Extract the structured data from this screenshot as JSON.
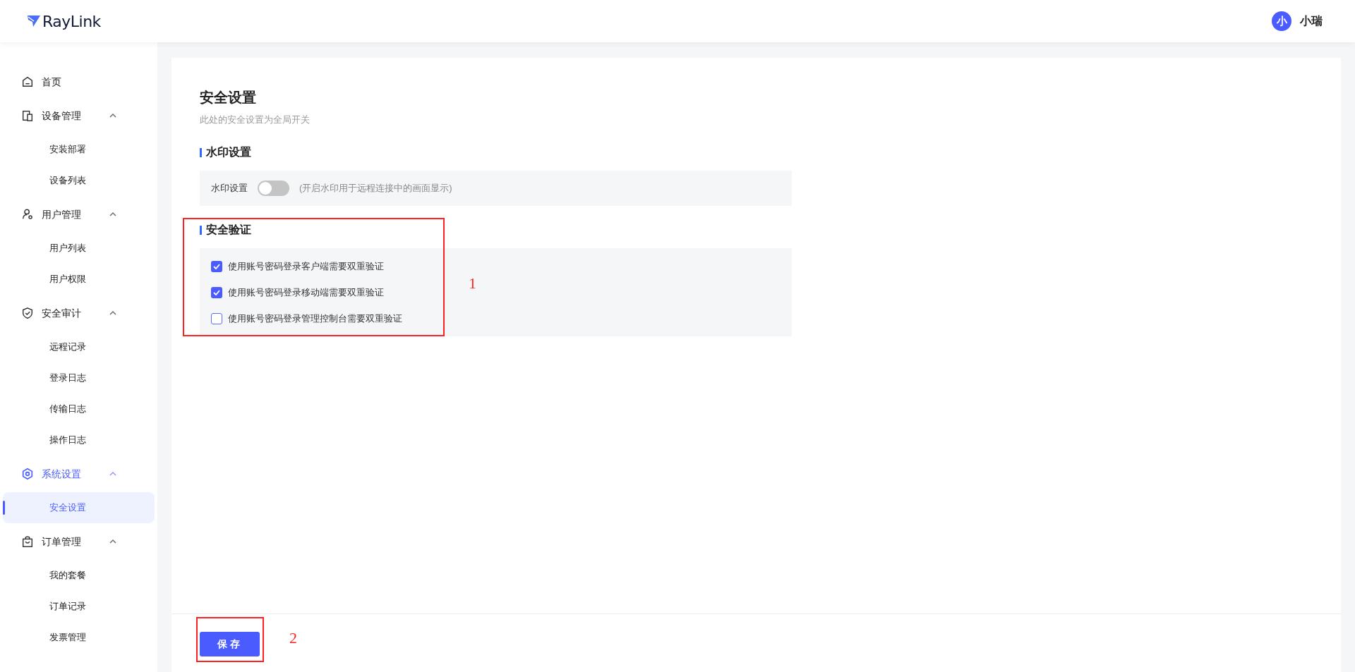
{
  "header": {
    "logo": "RayLink",
    "user": {
      "avatar": "小",
      "name": "小瑞"
    }
  },
  "sidebar": {
    "items": [
      {
        "label": "首页",
        "selected": false
      },
      {
        "label": "设备管理",
        "selected": false,
        "expanded": true,
        "children": [
          {
            "label": "安装部署",
            "selected": false
          },
          {
            "label": "设备列表",
            "selected": false
          }
        ]
      },
      {
        "label": "用户管理",
        "selected": false,
        "expanded": true,
        "children": [
          {
            "label": "用户列表",
            "selected": false
          },
          {
            "label": "用户权限",
            "selected": false
          }
        ]
      },
      {
        "label": "安全审计",
        "selected": false,
        "expanded": true,
        "children": [
          {
            "label": "远程记录",
            "selected": false
          },
          {
            "label": "登录日志",
            "selected": false
          },
          {
            "label": "传输日志",
            "selected": false
          },
          {
            "label": "操作日志",
            "selected": false
          }
        ]
      },
      {
        "label": "系统设置",
        "selected": false,
        "expanded": true,
        "children": [
          {
            "label": "安全设置",
            "selected": true
          }
        ]
      },
      {
        "label": "订单管理",
        "selected": false,
        "expanded": true,
        "children": [
          {
            "label": "我的套餐",
            "selected": false
          },
          {
            "label": "订单记录",
            "selected": false
          },
          {
            "label": "发票管理",
            "selected": false
          }
        ]
      }
    ]
  },
  "page": {
    "title": "安全设置",
    "subtitle": "此处的安全设置为全局开关",
    "sections": [
      {
        "heading": "水印设置",
        "kind": "toggle",
        "label": "水印设置",
        "on": false,
        "hint": "(开启水印用于远程连接中的画面显示)"
      },
      {
        "heading": "安全验证",
        "kind": "checklist",
        "options": [
          {
            "label": "使用账号密码登录客户端需要双重验证",
            "checked": true
          },
          {
            "label": "使用账号密码登录移动端需要双重验证",
            "checked": true
          },
          {
            "label": "使用账号密码登录管理控制台需要双重验证",
            "checked": false
          }
        ]
      }
    ]
  },
  "footer": {
    "save_button": "保存"
  },
  "annotations": [
    {
      "label": "1"
    },
    {
      "label": "2"
    }
  ]
}
